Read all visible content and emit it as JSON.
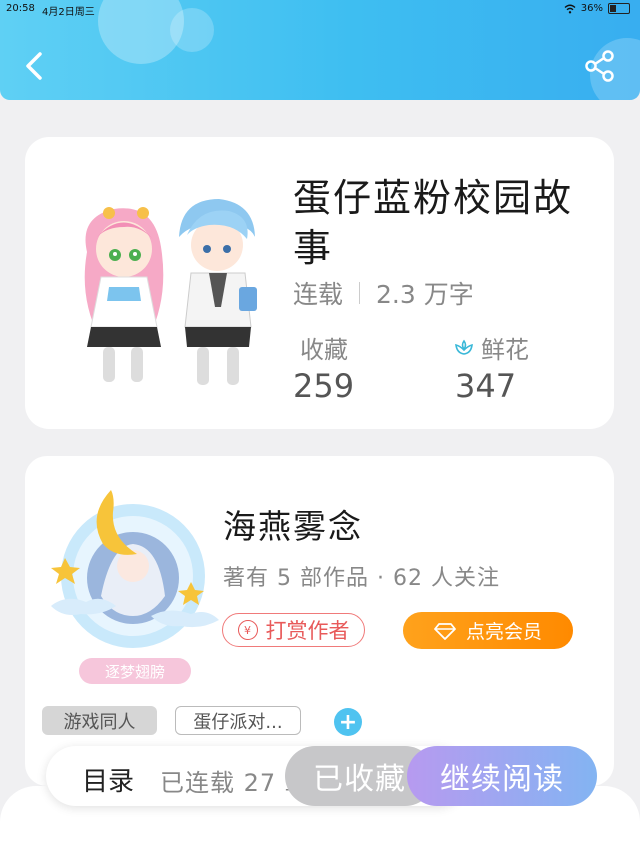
{
  "status_bar": {
    "time": "20:58",
    "date": "4月2日周三",
    "battery": "36%"
  },
  "header": {
    "back_icon": "chevron-left-icon",
    "share_icon": "share-icon",
    "gradient_colors": [
      "#5fd0f4",
      "#38aef0"
    ]
  },
  "book": {
    "title": "蛋仔蓝粉校园故事",
    "status": "连载",
    "word_count": "2.3 万字",
    "favorites_label": "收藏",
    "favorites_value": "259",
    "flowers_label": "鲜花",
    "flowers_value": "347"
  },
  "author": {
    "name": "海燕雾念",
    "info": "著有 5 部作品 · 62 人关注",
    "avatar_badge_text": "逐梦翅膀",
    "tip_button": "打赏作者",
    "vip_button": "点亮会员",
    "tags": [
      "游戏同人",
      "蛋仔派对..."
    ],
    "add_tag_symbol": "+"
  },
  "bottom_bar": {
    "toc_label": "目录",
    "toc_status": "已连载 27 章",
    "collected_button": "已收藏",
    "read_button": "继续阅读"
  },
  "colors": {
    "accent_blue": "#3ebef1",
    "tip_red": "#e85a5a",
    "vip_orange": "#ff8a00",
    "read_purple": "#b79af0"
  }
}
